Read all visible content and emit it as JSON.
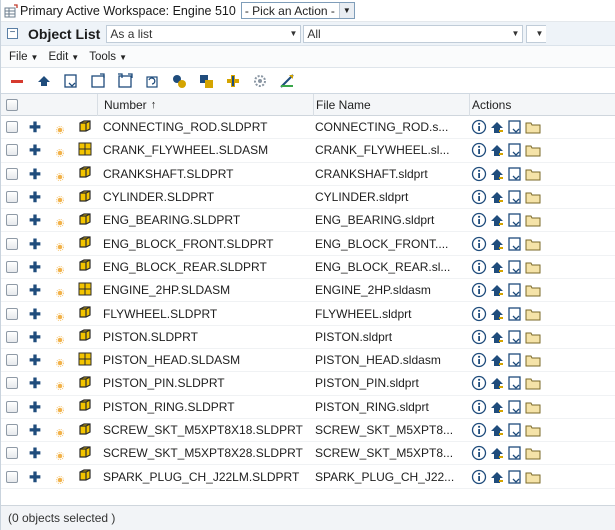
{
  "window": {
    "title": "Primary Active Workspace: Engine 510",
    "action_select": "- Pick an Action -"
  },
  "object_list": {
    "title": "Object List",
    "view_select": "As a list",
    "filter_select": "All"
  },
  "menus": [
    {
      "label": "File"
    },
    {
      "label": "Edit"
    },
    {
      "label": "Tools"
    }
  ],
  "toolbar_icons": [
    "remove-icon",
    "check-in-icon",
    "check-out-icon",
    "new-folder-icon",
    "open-folder-icon",
    "refresh-icon",
    "where-used-icon",
    "copy-icon",
    "add-icon",
    "settings-icon",
    "edit-icon"
  ],
  "table": {
    "columns": {
      "number": "Number",
      "sort_indicator": "↑",
      "file_name": "File Name",
      "actions": "Actions"
    },
    "rows": [
      {
        "type": "part",
        "number": "CONNECTING_ROD.SLDPRT",
        "file": "CONNECTING_ROD.s..."
      },
      {
        "type": "assembly",
        "number": "CRANK_FLYWHEEL.SLDASM",
        "file": "CRANK_FLYWHEEL.sl..."
      },
      {
        "type": "part",
        "number": "CRANKSHAFT.SLDPRT",
        "file": "CRANKSHAFT.sldprt"
      },
      {
        "type": "part",
        "number": "CYLINDER.SLDPRT",
        "file": "CYLINDER.sldprt"
      },
      {
        "type": "part",
        "number": "ENG_BEARING.SLDPRT",
        "file": "ENG_BEARING.sldprt"
      },
      {
        "type": "part",
        "number": "ENG_BLOCK_FRONT.SLDPRT",
        "file": "ENG_BLOCK_FRONT...."
      },
      {
        "type": "part",
        "number": "ENG_BLOCK_REAR.SLDPRT",
        "file": "ENG_BLOCK_REAR.sl..."
      },
      {
        "type": "assembly",
        "number": "ENGINE_2HP.SLDASM",
        "file": "ENGINE_2HP.sldasm"
      },
      {
        "type": "part",
        "number": "FLYWHEEL.SLDPRT",
        "file": "FLYWHEEL.sldprt"
      },
      {
        "type": "part",
        "number": "PISTON.SLDPRT",
        "file": "PISTON.sldprt"
      },
      {
        "type": "assembly",
        "number": "PISTON_HEAD.SLDASM",
        "file": "PISTON_HEAD.sldasm"
      },
      {
        "type": "part",
        "number": "PISTON_PIN.SLDPRT",
        "file": "PISTON_PIN.sldprt"
      },
      {
        "type": "part",
        "number": "PISTON_RING.SLDPRT",
        "file": "PISTON_RING.sldprt"
      },
      {
        "type": "part",
        "number": "SCREW_SKT_M5XPT8X18.SLDPRT",
        "file": "SCREW_SKT_M5XPT8..."
      },
      {
        "type": "part",
        "number": "SCREW_SKT_M5XPT8X28.SLDPRT",
        "file": "SCREW_SKT_M5XPT8..."
      },
      {
        "type": "part",
        "number": "SPARK_PLUG_CH_J22LM.SLDPRT",
        "file": "SPARK_PLUG_CH_J22..."
      }
    ]
  },
  "status": {
    "text": "(0 objects selected )"
  },
  "colors": {
    "accent": "#1f4c7c",
    "part_icon": "#d4a400",
    "remove": "#d63a2e",
    "header_bg": "#eef3f8"
  }
}
